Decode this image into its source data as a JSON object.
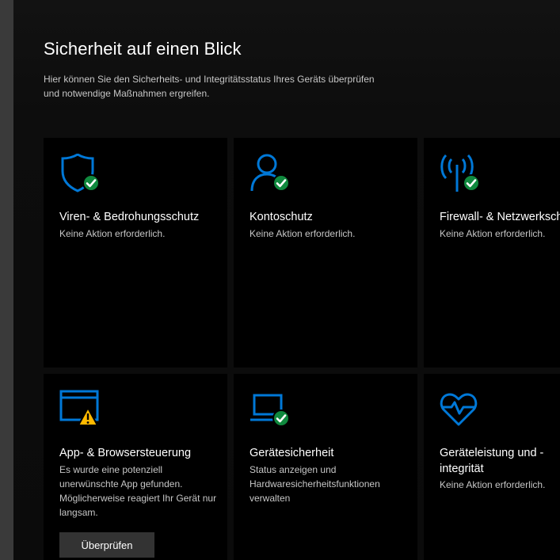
{
  "page": {
    "title": "Sicherheit auf einen Blick",
    "description": "Hier können Sie den Sicherheits- und Integritätsstatus Ihres Geräts überprüfen und notwendige Maßnahmen ergreifen."
  },
  "colors": {
    "accent": "#0078d7",
    "ok": "#10893e",
    "warning": "#ffb900",
    "tile_bg": "#000000",
    "button_bg": "#333333"
  },
  "tiles": [
    {
      "icon": "shield-icon",
      "badge": "check-badge-icon",
      "title": "Viren- & Bedrohungsschutz",
      "text": "Keine Aktion erforderlich."
    },
    {
      "icon": "person-icon",
      "badge": "check-badge-icon",
      "title": "Kontoschutz",
      "text": "Keine Aktion erforderlich."
    },
    {
      "icon": "wireless-antenna-icon",
      "badge": "check-badge-icon",
      "title": "Firewall- & Netzwerkschutz",
      "text": "Keine Aktion erforderlich."
    },
    {
      "icon": "app-browser-window-icon",
      "badge": "warning-badge-icon",
      "title": "App- & Browsersteuerung",
      "text": "Es wurde eine potenziell unerwünschte App gefunden. Möglicherweise reagiert Ihr Gerät nur langsam.",
      "button": "Überprüfen"
    },
    {
      "icon": "laptop-icon",
      "badge": "check-badge-icon",
      "title": "Gerätesicherheit",
      "text": "Status anzeigen und Hardwaresicherheitsfunktionen verwalten"
    },
    {
      "icon": "heart-pulse-icon",
      "title": "Geräteleistung und -integrität",
      "text": "Keine Aktion erforderlich."
    }
  ]
}
